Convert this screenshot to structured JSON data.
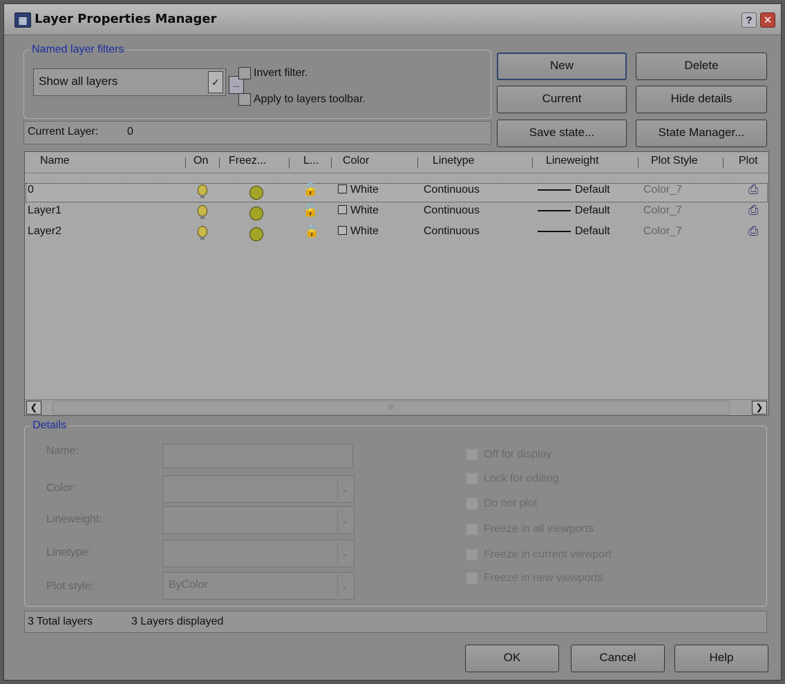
{
  "window": {
    "title": "Layer Properties Manager",
    "app_icon": "layer-properties-icon"
  },
  "filters": {
    "group_label": "Named layer filters",
    "selected": "Show all layers",
    "browse_label": "...",
    "invert_label": "Invert filter.",
    "apply_label": "Apply to layers toolbar."
  },
  "buttons": {
    "new": "New",
    "delete": "Delete",
    "current": "Current",
    "hide_details": "Hide details",
    "save_state": "Save state...",
    "state_manager": "State Manager...",
    "ok": "OK",
    "cancel": "Cancel",
    "help": "Help"
  },
  "current_layer": {
    "label": "Current Layer:",
    "value": "0"
  },
  "table": {
    "columns": [
      "Name",
      "On",
      "Freez...",
      "L...",
      "Color",
      "Linetype",
      "Lineweight",
      "Plot Style",
      "Plot"
    ],
    "rows": [
      {
        "name": "0",
        "color": "White",
        "linetype": "Continuous",
        "lineweight": "Default",
        "plot_style": "Color_7",
        "lock_icon": "unlocked",
        "selected": true
      },
      {
        "name": "Layer1",
        "color": "White",
        "linetype": "Continuous",
        "lineweight": "Default",
        "plot_style": "Color_7",
        "lock_icon": "unlocked",
        "selected": false
      },
      {
        "name": "Layer2",
        "color": "White",
        "linetype": "Continuous",
        "lineweight": "Default",
        "plot_style": "Color_7",
        "lock_icon": "locked",
        "selected": false
      }
    ],
    "scroll_grip": "III"
  },
  "details": {
    "group_label": "Details",
    "name_label": "Name:",
    "color_label": "Color:",
    "lineweight_label": "Lineweight:",
    "linetype_label": "Linetype:",
    "plotstyle_label": "Plot style:",
    "plotstyle_value": "ByColor",
    "checks": [
      "Off for display",
      "Lock for editing",
      "Do not plot",
      "Freeze in all viewports",
      "Freeze in current viewport",
      "Freeze in new viewports"
    ]
  },
  "status": {
    "total": "3 Total layers",
    "displayed": "3 Layers displayed"
  }
}
